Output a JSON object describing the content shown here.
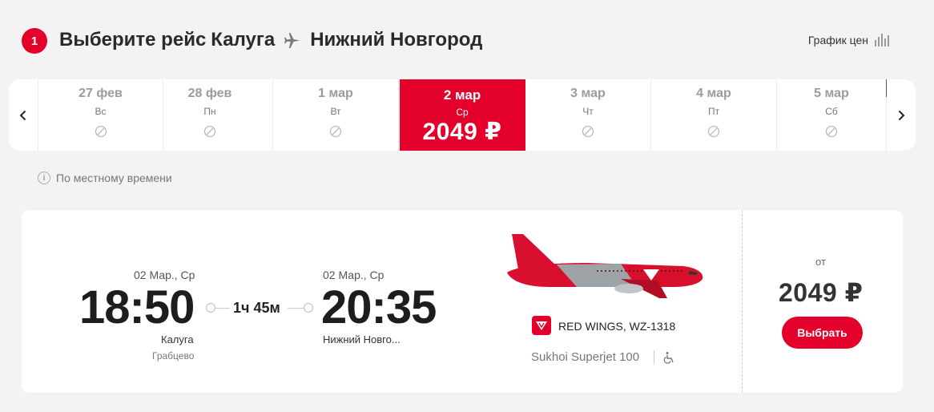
{
  "header": {
    "step_number": "1",
    "title_prefix": "Выберите рейс",
    "origin": "Калуга",
    "destination": "Нижний Новгород",
    "price_chart_label": "График цен"
  },
  "date_strip": {
    "days": [
      {
        "date": "27 фев",
        "dow": "Вс",
        "available": false
      },
      {
        "date": "28 фев",
        "dow": "Пн",
        "available": false
      },
      {
        "date": "1 мар",
        "dow": "Вт",
        "available": false
      },
      {
        "date": "2 мар",
        "dow": "Ср",
        "available": true,
        "price": "2049 ₽",
        "selected": true
      },
      {
        "date": "3 мар",
        "dow": "Чт",
        "available": false
      },
      {
        "date": "4 мар",
        "dow": "Пт",
        "available": false
      },
      {
        "date": "5 мар",
        "dow": "Сб",
        "available": false
      }
    ]
  },
  "local_time_note": "По местному времени",
  "flight": {
    "departure": {
      "date": "02 Мар., Ср",
      "time": "18:50",
      "city": "Калуга",
      "airport": "Грабцево"
    },
    "duration": "1ч 45м",
    "arrival": {
      "date": "02 Мар., Ср",
      "time": "20:35",
      "city": "Нижний Новго..."
    },
    "airline": "RED WINGS, WZ-1318",
    "aircraft": "Sukhoi Superjet 100",
    "price_from_label": "от",
    "price": "2049 ₽",
    "select_label": "Выбрать"
  },
  "colors": {
    "brand": "#e3002b",
    "background": "#f3f3f4"
  },
  "icons": [
    "plane-icon",
    "bar-chart-icon",
    "chevron-left-icon",
    "chevron-right-icon",
    "unavailable-icon",
    "info-icon",
    "airline-logo",
    "wheelchair-icon"
  ]
}
